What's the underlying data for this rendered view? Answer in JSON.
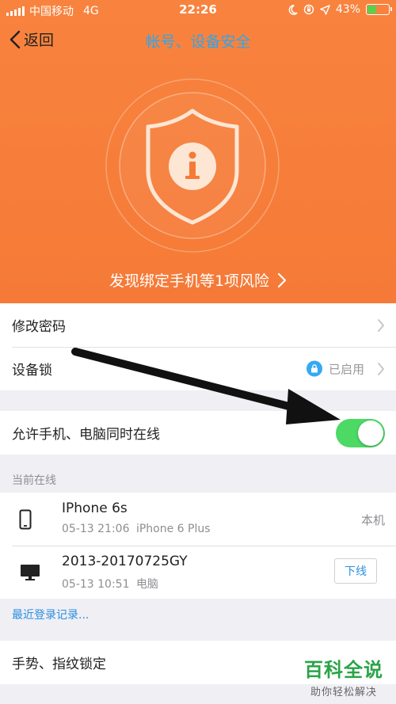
{
  "status": {
    "carrier": "中国移动",
    "network": "4G",
    "time": "22:26",
    "battery": "43%",
    "battery_level": 0.43
  },
  "nav": {
    "back_label": "返回",
    "title": "帐号、设备安全"
  },
  "hero": {
    "risk_text": "发现绑定手机等1项风险"
  },
  "settings": {
    "change_password": "修改密码",
    "device_lock": "设备锁",
    "device_lock_status": "已启用",
    "allow_online": "允许手机、电脑同时在线",
    "allow_online_on": true
  },
  "online": {
    "section_title": "当前在线",
    "devices": [
      {
        "name": "IPhone 6s",
        "time": "05-13 21:06",
        "detail": "iPhone 6 Plus",
        "tag": "本机"
      },
      {
        "name": "2013-20170725GY",
        "time": "05-13 10:51",
        "detail": "电脑",
        "action": "下线"
      }
    ],
    "recent_link": "最近登录记录..."
  },
  "more": {
    "gesture_lock": "手势、指纹锁定"
  },
  "watermark": {
    "title": "百科全说",
    "subtitle": "助你轻松解决"
  },
  "colors": {
    "hero_orange": "#f57a37",
    "title_blue": "#33a5e8",
    "toggle_green": "#4cd964",
    "link_blue": "#2a8fe0"
  }
}
